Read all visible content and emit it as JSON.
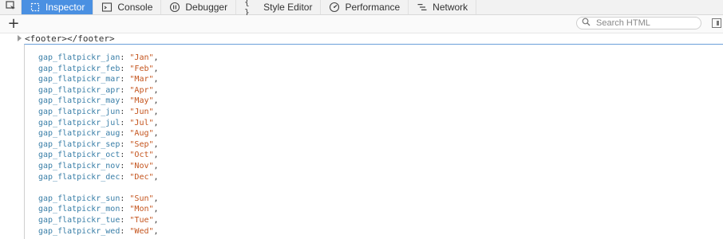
{
  "tabs": [
    {
      "label": "Inspector",
      "icon": "inspector-icon",
      "active": true
    },
    {
      "label": "Console",
      "icon": "console-icon",
      "active": false
    },
    {
      "label": "Debugger",
      "icon": "debugger-icon",
      "active": false
    },
    {
      "label": "Style Editor",
      "icon": "style-editor-icon",
      "active": false
    },
    {
      "label": "Performance",
      "icon": "performance-icon",
      "active": false
    },
    {
      "label": "Network",
      "icon": "network-icon",
      "active": false
    }
  ],
  "toolbar": {
    "add_label": "+",
    "search_placeholder": "Search HTML"
  },
  "breadcrumb": {
    "text": "<footer></footer>"
  },
  "code": {
    "lines": [
      {
        "key": "gap_flatpickr_jan",
        "value": "\"Jan\""
      },
      {
        "key": "gap_flatpickr_feb",
        "value": "\"Feb\""
      },
      {
        "key": "gap_flatpickr_mar",
        "value": "\"Mar\""
      },
      {
        "key": "gap_flatpickr_apr",
        "value": "\"Apr\""
      },
      {
        "key": "gap_flatpickr_may",
        "value": "\"May\""
      },
      {
        "key": "gap_flatpickr_jun",
        "value": "\"Jun\""
      },
      {
        "key": "gap_flatpickr_jul",
        "value": "\"Jul\""
      },
      {
        "key": "gap_flatpickr_aug",
        "value": "\"Aug\""
      },
      {
        "key": "gap_flatpickr_sep",
        "value": "\"Sep\""
      },
      {
        "key": "gap_flatpickr_oct",
        "value": "\"Oct\""
      },
      {
        "key": "gap_flatpickr_nov",
        "value": "\"Nov\""
      },
      {
        "key": "gap_flatpickr_dec",
        "value": "\"Dec\""
      },
      {
        "blank": true
      },
      {
        "key": "gap_flatpickr_sun",
        "value": "\"Sun\""
      },
      {
        "key": "gap_flatpickr_mon",
        "value": "\"Mon\""
      },
      {
        "key": "gap_flatpickr_tue",
        "value": "\"Tue\""
      },
      {
        "key": "gap_flatpickr_wed",
        "value": "\"Wed\""
      }
    ]
  },
  "colors": {
    "active_tab": "#4a90e2",
    "code_key": "#3a7fa8",
    "code_value": "#c4541d"
  }
}
